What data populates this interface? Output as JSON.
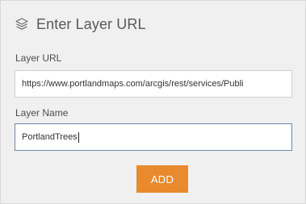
{
  "dialog": {
    "title": "Enter Layer URL",
    "icon": "layers-icon"
  },
  "fields": {
    "layer_url": {
      "label": "Layer URL",
      "value": "https://www.portlandmaps.com/arcgis/rest/services/Publi"
    },
    "layer_name": {
      "label": "Layer Name",
      "value": "PortlandTrees"
    }
  },
  "actions": {
    "add_label": "ADD"
  },
  "colors": {
    "panel_background": "#f0f0f0",
    "add_button": "#e88a2d",
    "focused_border": "#6a88a7"
  }
}
